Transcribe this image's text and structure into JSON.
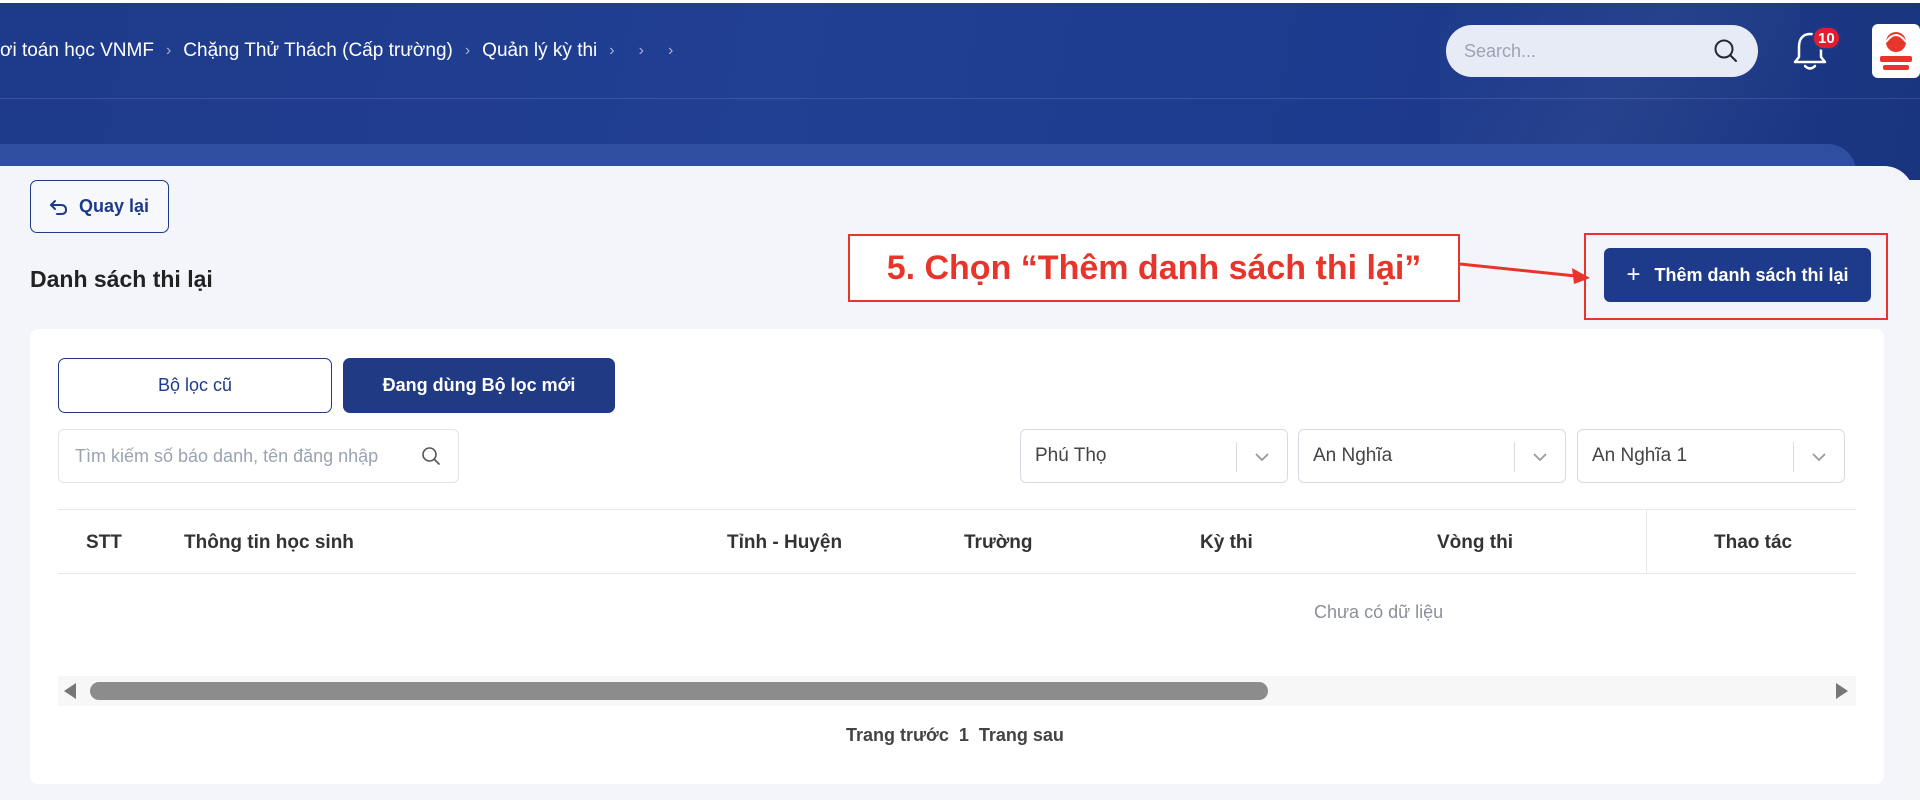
{
  "header": {
    "breadcrumb": [
      "ơi toán học VNMF",
      "Chặng Thử Thách (Cấp trường)",
      "Quản lý kỳ thi",
      "",
      ""
    ],
    "search_placeholder": "Search...",
    "notification_count": "10"
  },
  "page": {
    "back_label": "Quay lại",
    "title": "Danh sách thi lại",
    "add_label": "Thêm danh sách thi lại"
  },
  "annotation": {
    "text": "5. Chọn “Thêm danh sách thi lại”",
    "color": "#e8352b"
  },
  "filters": {
    "old_label": "Bộ lọc cũ",
    "new_label": "Đang dùng Bộ lọc mới",
    "search_placeholder": "Tìm kiếm số báo danh, tên đăng nhập",
    "province": "Phú Thọ",
    "district": "An Nghĩa",
    "school": "An Nghĩa 1"
  },
  "table": {
    "columns": [
      "STT",
      "Thông tin học sinh",
      "Tỉnh - Huyện",
      "Trường",
      "Kỳ thi",
      "Vòng thi",
      "Thao tác"
    ],
    "empty_text": "Chưa có dữ liệu"
  },
  "pagination": {
    "prev": "Trang trước",
    "current": "1",
    "next": "Trang sau"
  },
  "colors": {
    "primary": "#1e3a8a",
    "accent_red": "#e8352b"
  }
}
